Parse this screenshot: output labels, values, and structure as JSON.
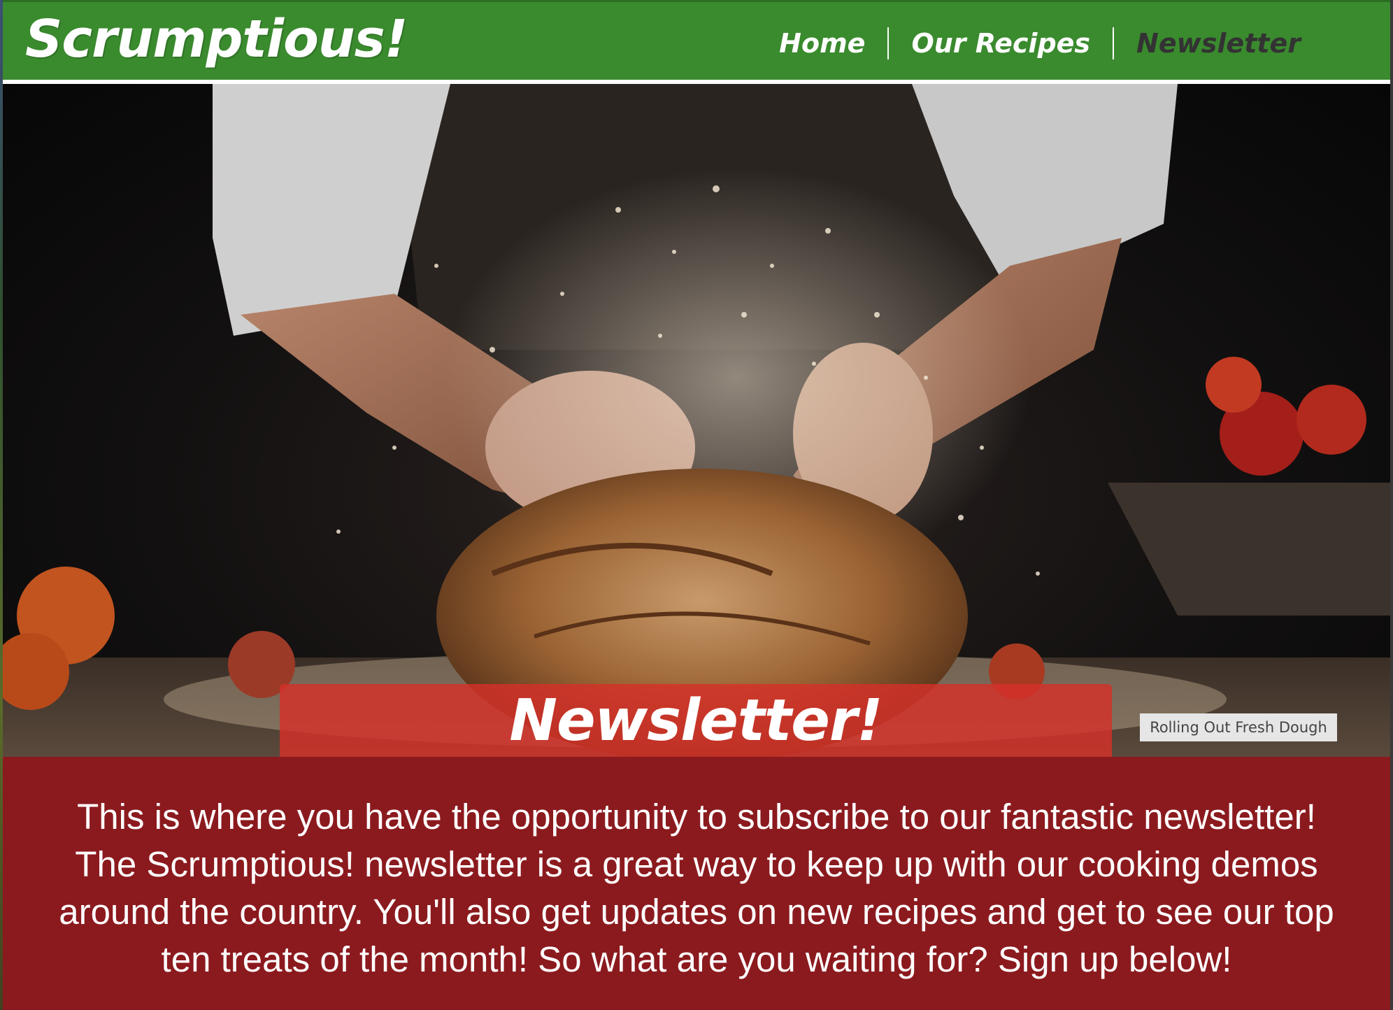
{
  "header": {
    "logo": "Scrumptious!",
    "nav": [
      {
        "label": "Home",
        "active": false
      },
      {
        "label": "Our Recipes",
        "active": false
      },
      {
        "label": "Newsletter",
        "active": true
      }
    ]
  },
  "hero": {
    "caption": "Rolling Out Fresh Dough"
  },
  "section": {
    "title": "Newsletter!",
    "intro": "This is where you have the opportunity to subscribe to our fantastic newsletter! The Scrumptious! newsletter is a great way to keep up with our cooking demos around the country. You'll also get updates on new recipes and get to see our top ten treats of the month! So what are you waiting for? Sign up below!"
  },
  "colors": {
    "header_green": "#3a8a2e",
    "banner_red": "#d63028",
    "body_red": "#8b1a1e",
    "active_nav": "#333333"
  }
}
